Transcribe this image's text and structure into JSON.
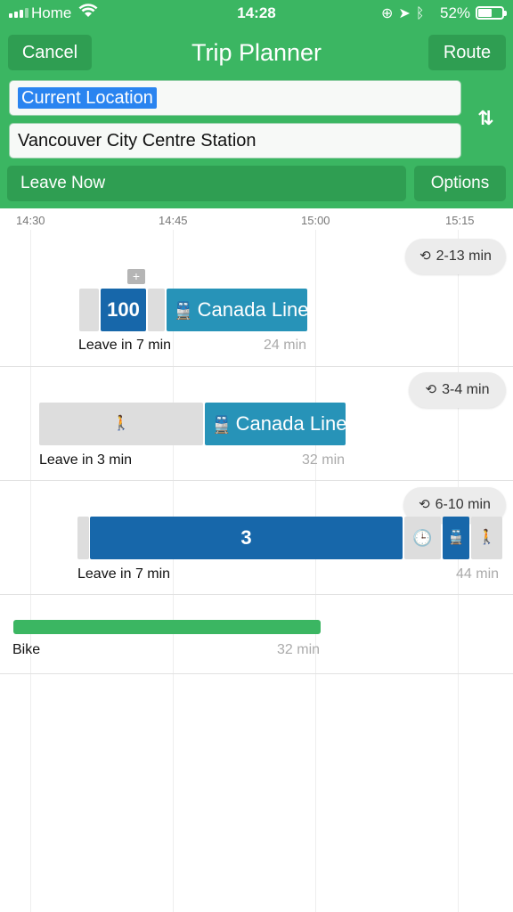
{
  "status_bar": {
    "carrier": "Home",
    "time": "14:28",
    "battery": "52%",
    "battery_level": 0.52
  },
  "header": {
    "cancel_label": "Cancel",
    "title": "Trip Planner",
    "route_label": "Route",
    "from": "Current Location",
    "to": "Vancouver City Centre Station",
    "swap_icon": "swap-vertical-icon",
    "leave_label": "Leave Now",
    "options_label": "Options"
  },
  "timeline": {
    "ticks": [
      "14:30",
      "14:45",
      "15:00",
      "15:15"
    ]
  },
  "trips": [
    {
      "frequency": "2-13 min",
      "route_number": "100",
      "line": "Canada Line",
      "more_label": "+",
      "leave": "Leave in 7 min",
      "duration": "24 min"
    },
    {
      "frequency": "3-4 min",
      "line": "Canada Line",
      "leave": "Leave in 3 min",
      "duration": "32 min"
    },
    {
      "frequency": "6-10 min",
      "route_number": "3",
      "leave": "Leave in 7 min",
      "duration": "44 min"
    }
  ],
  "bike": {
    "label": "Bike",
    "duration": "32 min"
  },
  "colors": {
    "header_green": "#3bb662",
    "button_green": "#2f9e52",
    "bus_blue": "#1767aa",
    "rail_blue": "#2793b8",
    "selection_blue": "#2a84f0"
  }
}
